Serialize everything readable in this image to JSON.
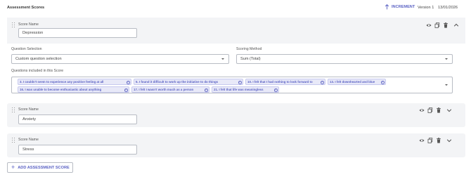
{
  "header": {
    "title": "Assessment Scores",
    "increment_label": "INCREMENT",
    "version": "Version 1",
    "date": "13/01/2026"
  },
  "scores": [
    {
      "name_label": "Score Name",
      "name_value": "Depression",
      "question_selection_label": "Question Selection",
      "question_selection_value": "Custom question selection",
      "scoring_method_label": "Scoring Method",
      "scoring_method_value": "Sum (Total)",
      "questions_label": "Questions included in this Score",
      "questions": [
        "3. I couldn't seem to experience any positive feeling at all",
        "5. I found it difficult to work up the initiative to do things",
        "10. I felt that I had nothing to look forward to",
        "13. I felt downhearted and blue",
        "16. I was unable to become enthusiastic about anything",
        "17. I felt I wasn't worth much as a person",
        "21. I felt that life was meaningless"
      ]
    },
    {
      "name_label": "Score Name",
      "name_value": "Anxiety"
    },
    {
      "name_label": "Score Name",
      "name_value": "Stress"
    }
  ],
  "add_button_label": "ADD ASSESSMENT SCORE",
  "icons": {
    "view": "eye-icon",
    "copy": "copy-icon",
    "delete": "trash-icon",
    "collapse": "chevron-up-icon",
    "expand": "chevron-down-icon",
    "drag": "drag-handle-icon",
    "chip_remove": "close-circle-icon",
    "add": "plus-icon",
    "increment": "arrow-up-icon"
  },
  "colors": {
    "accent": "#5b62c4",
    "card_bg": "#f3f4f6",
    "chip_bg": "#e8e9f8"
  }
}
